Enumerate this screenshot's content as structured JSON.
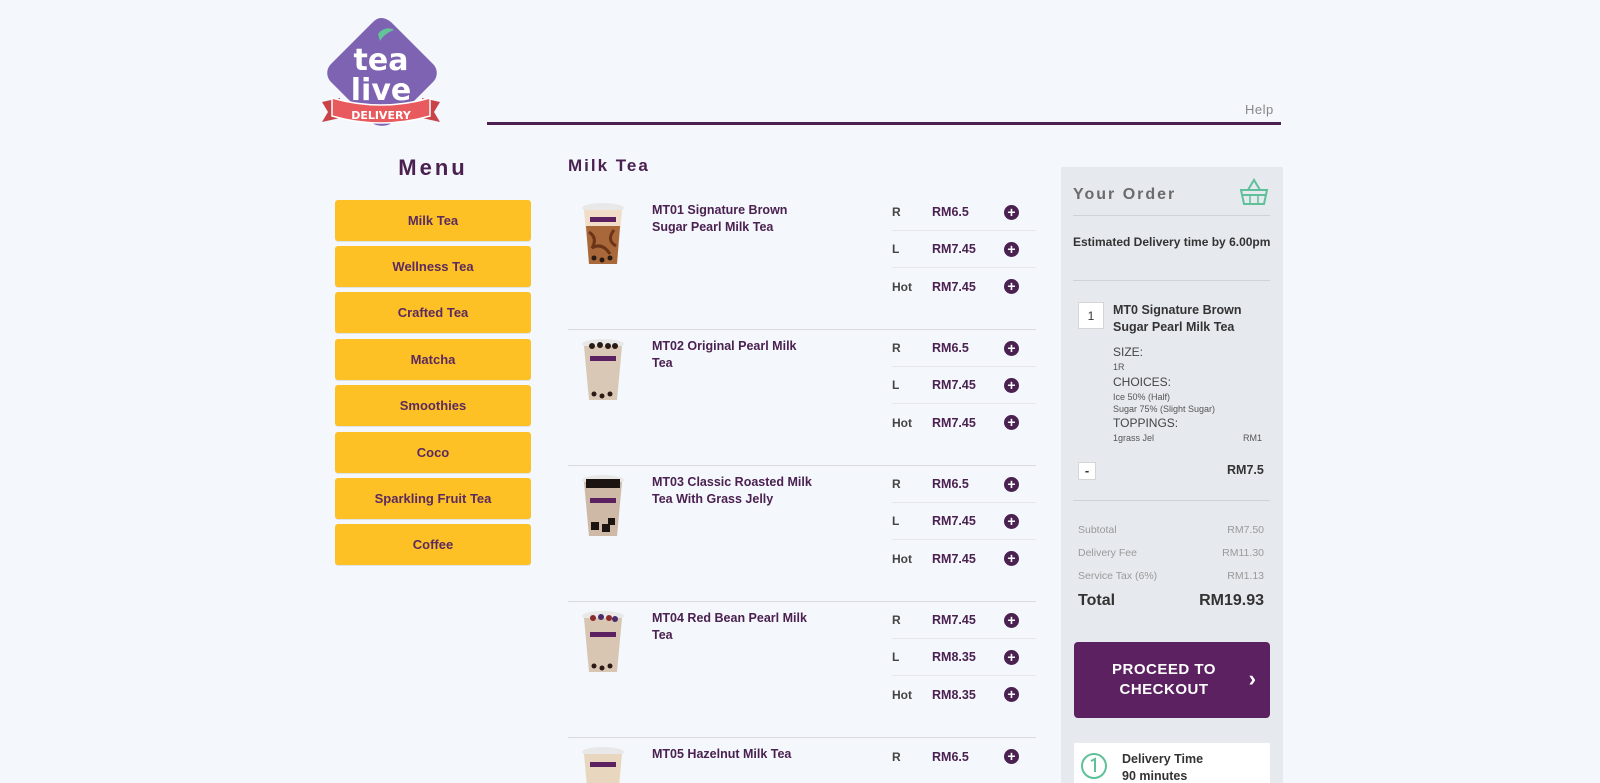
{
  "brand": {
    "logo_word1": "tea",
    "logo_word2": "live",
    "logo_ribbon": "DELIVERY",
    "accent": "#4a2151",
    "button_color": "#fdc126"
  },
  "header": {
    "help": "Help"
  },
  "menu": {
    "title": "Menu",
    "items": [
      "Milk Tea",
      "Wellness Tea",
      "Crafted Tea",
      "Matcha",
      "Smoothies",
      "Coco",
      "Sparkling Fruit Tea",
      "Coffee"
    ]
  },
  "category": {
    "title": "Milk Tea",
    "products": [
      {
        "name": "MT01 Signature Brown Sugar Pearl Milk Tea",
        "image": "brown-sugar-cup",
        "sizes": [
          {
            "size": "R",
            "price": "RM6.5"
          },
          {
            "size": "L",
            "price": "RM7.45"
          },
          {
            "size": "Hot",
            "price": "RM7.45"
          }
        ]
      },
      {
        "name": "MT02 Original Pearl Milk Tea",
        "image": "pearl-cup",
        "sizes": [
          {
            "size": "R",
            "price": "RM6.5"
          },
          {
            "size": "L",
            "price": "RM7.45"
          },
          {
            "size": "Hot",
            "price": "RM7.45"
          }
        ]
      },
      {
        "name": "MT03 Classic Roasted Milk Tea With Grass Jelly",
        "image": "grass-jelly-cup",
        "sizes": [
          {
            "size": "R",
            "price": "RM6.5"
          },
          {
            "size": "L",
            "price": "RM7.45"
          },
          {
            "size": "Hot",
            "price": "RM7.45"
          }
        ]
      },
      {
        "name": "MT04 Red Bean Pearl Milk Tea",
        "image": "red-bean-cup",
        "sizes": [
          {
            "size": "R",
            "price": "RM7.45"
          },
          {
            "size": "L",
            "price": "RM8.35"
          },
          {
            "size": "Hot",
            "price": "RM8.35"
          }
        ]
      },
      {
        "name": "MT05 Hazelnut Milk Tea",
        "image": "hazelnut-cup",
        "sizes": [
          {
            "size": "R",
            "price": "RM6.5"
          }
        ]
      }
    ]
  },
  "order": {
    "title": "Your Order",
    "eta": "Estimated Delivery time by 6.00pm",
    "item": {
      "qty": "1",
      "name": "MT0 Signature Brown Sugar Pearl Milk Tea",
      "size_head": "SIZE:",
      "size_val": "1R",
      "choices_head": "CHOICES:",
      "choice1": "Ice 50% (Half)",
      "choice2": "Sugar 75% (Slight Sugar)",
      "toppings_head": "TOPPINGS:",
      "topping1": "1grass Jel",
      "topping1_price": "RM1",
      "minus": "-",
      "total": "RM7.5"
    },
    "summary": {
      "subtotal_label": "Subtotal",
      "subtotal": "RM7.50",
      "delivery_label": "Delivery Fee",
      "delivery": "RM11.30",
      "tax_label": "Service Tax (6%)",
      "tax": "RM1.13",
      "total_label": "Total",
      "total": "RM19.93"
    },
    "checkout": "PROCEED TO CHECKOUT",
    "delivery_time_label": "Delivery Time",
    "delivery_time_value": "90 minutes"
  }
}
